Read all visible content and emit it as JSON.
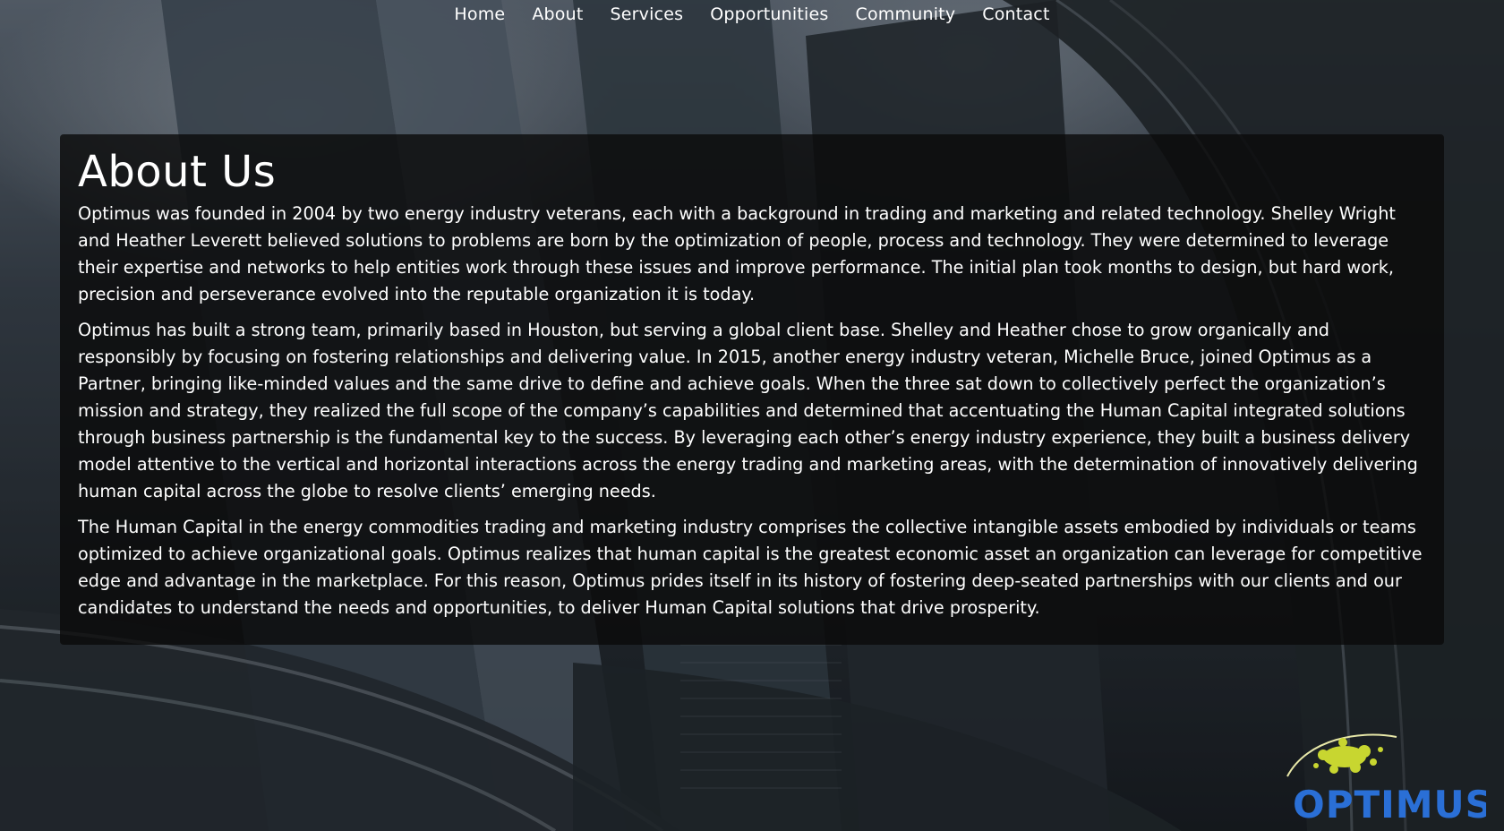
{
  "nav": {
    "items": [
      "Home",
      "About",
      "Services",
      "Opportunities",
      "Community",
      "Contact"
    ]
  },
  "about": {
    "title": "About Us",
    "paragraphs": [
      "Optimus was founded in 2004 by two energy industry veterans, each with a background in trading and marketing and related technology. Shelley Wright and Heather Leverett believed solutions to problems are born by the optimization of people, process and technology. They were determined to leverage their expertise and networks to help entities work through these issues and improve performance. The initial plan took months to design, but hard work, precision and perseverance evolved into the reputable organization it is today.",
      "Optimus has built a strong team, primarily based in Houston, but serving a global client base. Shelley and Heather chose to grow organically and responsibly by focusing on fostering relationships and delivering value. In 2015, another energy industry veteran, Michelle Bruce, joined Optimus as a Partner, bringing like-minded values and the same drive to define and achieve goals. When the three sat down to collectively perfect the organization’s mission and strategy, they realized the full scope of the company’s capabilities and determined that accentuating the Human Capital integrated solutions through business partnership is the fundamental key to the success. By leveraging each other’s energy industry experience, they built a business delivery model attentive to the vertical and horizontal interactions across the energy trading and marketing areas, with the determination of innovatively delivering human capital across the globe to resolve clients’ emerging needs.",
      "The Human Capital in the energy commodities trading and marketing industry comprises the collective intangible assets embodied by individuals or teams optimized to achieve organizational goals. Optimus realizes that human capital is the greatest economic asset an organization can leverage for competitive edge and advantage in the marketplace. For this reason, Optimus prides itself in its history of fostering deep-seated partnerships with our clients and our candidates to understand the needs and opportunities, to deliver Human Capital solutions that drive prosperity."
    ]
  },
  "logo": {
    "text": "OPTIMUS",
    "colors": {
      "text": "#2a6fd6",
      "splash": "#c8d630",
      "arc": "#e7e7a8"
    }
  }
}
